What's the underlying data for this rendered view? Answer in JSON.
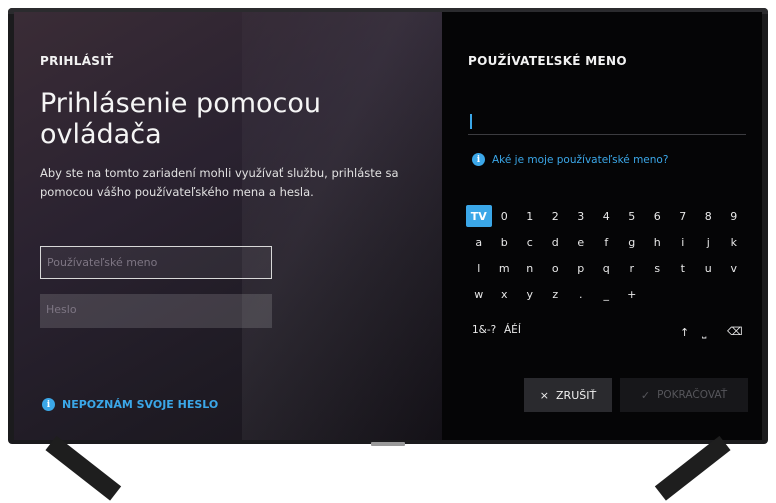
{
  "left": {
    "section": "PRIHLÁSIŤ",
    "title": "Prihlásenie pomocou ovládača",
    "description": "Aby ste na tomto zariadení mohli využívať službu, prihláste sa pomocou vášho používateľského mena a hesla.",
    "username_placeholder": "Používateľské meno",
    "password_placeholder": "Heslo",
    "forgot_password": "NEPOZNÁM SVOJE HESLO"
  },
  "right": {
    "section": "POUŽÍVATEĽSKÉ MENO",
    "username_value": "",
    "help": "Aké je moje používateľské meno?"
  },
  "keyboard": {
    "row1": [
      "TV",
      "0",
      "1",
      "2",
      "3",
      "4",
      "5",
      "6",
      "7",
      "8",
      "9"
    ],
    "row2": [
      "a",
      "b",
      "c",
      "d",
      "e",
      "f",
      "g",
      "h",
      "i",
      "j",
      "k"
    ],
    "row3": [
      "l",
      "m",
      "n",
      "o",
      "p",
      "q",
      "r",
      "s",
      "t",
      "u",
      "v"
    ],
    "row4": [
      "w",
      "x",
      "y",
      "z",
      ".",
      "_",
      "+"
    ],
    "active_key": "TV",
    "symbols_mode": "1&-?",
    "accents_mode": "ÁÉÍ",
    "shift": "↑",
    "space": "⎵",
    "backspace": "⌫"
  },
  "buttons": {
    "cancel": "ZRUŠIŤ",
    "cancel_icon": "×",
    "continue": "POKRAČOVAŤ",
    "continue_icon": "✓"
  },
  "colors": {
    "accent": "#3ba7e8"
  }
}
